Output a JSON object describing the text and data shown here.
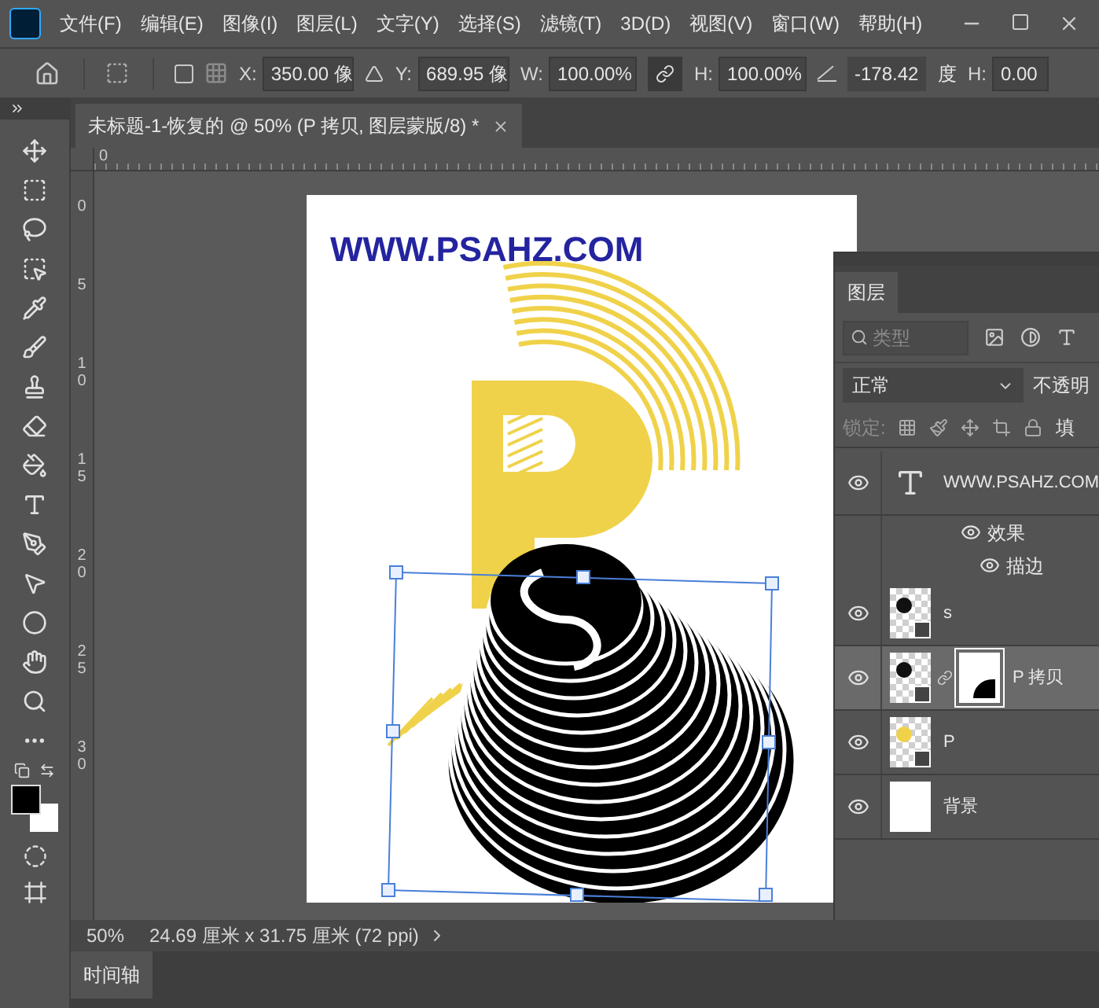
{
  "menu_bar": {
    "items": [
      "文件(F)",
      "编辑(E)",
      "图像(I)",
      "图层(L)",
      "文字(Y)",
      "选择(S)",
      "滤镜(T)",
      "3D(D)",
      "视图(V)",
      "窗口(W)",
      "帮助(H)"
    ]
  },
  "options_bar": {
    "x": {
      "label": "X:",
      "value": "350.00 像"
    },
    "y": {
      "label": "Y:",
      "value": "689.95 像"
    },
    "w": {
      "label": "W:",
      "value": "100.00%"
    },
    "checkbox": {
      "checked": false
    },
    "link": {
      "selected": true
    },
    "h": {
      "label": "H:",
      "value": "100.00%"
    },
    "angle": {
      "value": "-178.42",
      "unit": "度"
    },
    "skew_h": {
      "label": "H:",
      "value": "0.00"
    }
  },
  "document_tab": {
    "title": "未标题-1-恢复的 @ 50% (P 拷贝, 图层蒙版/8) *",
    "selected": true
  },
  "rulers": {
    "horizontal": [
      "0"
    ],
    "vertical": [
      "0",
      "5",
      "10",
      "15",
      "20",
      "25",
      "30"
    ]
  },
  "canvas": {
    "text": "WWW.PSAHZ.COM"
  },
  "layers_panel": {
    "tab": "图层",
    "filter": {
      "placeholder": "类型"
    },
    "blend_mode": "正常",
    "opacity_label": "不透明",
    "lock_label": "锁定:",
    "fill_label": "填",
    "layers": [
      {
        "name": "WWW.PSAHZ.COM",
        "kind": "text",
        "visible": true,
        "selected": false,
        "mask": false,
        "children": [
          {
            "name": "效果",
            "visible": true,
            "children": [
              {
                "name": "描边",
                "visible": true
              }
            ]
          }
        ]
      },
      {
        "name": "s",
        "kind": "smart",
        "visible": true,
        "selected": false,
        "mask": false
      },
      {
        "name": "P 拷贝",
        "kind": "smart",
        "visible": true,
        "selected": true,
        "mask": true
      },
      {
        "name": "P",
        "kind": "smart-yellow",
        "visible": true,
        "selected": false,
        "mask": false
      },
      {
        "name": "背景",
        "kind": "background",
        "visible": true,
        "selected": false,
        "mask": false
      }
    ]
  },
  "status_bar": {
    "zoom": "50%",
    "info": "24.69 厘米 x 31.75 厘米 (72 ppi)"
  },
  "bottom_tab": {
    "label": "时间轴"
  }
}
